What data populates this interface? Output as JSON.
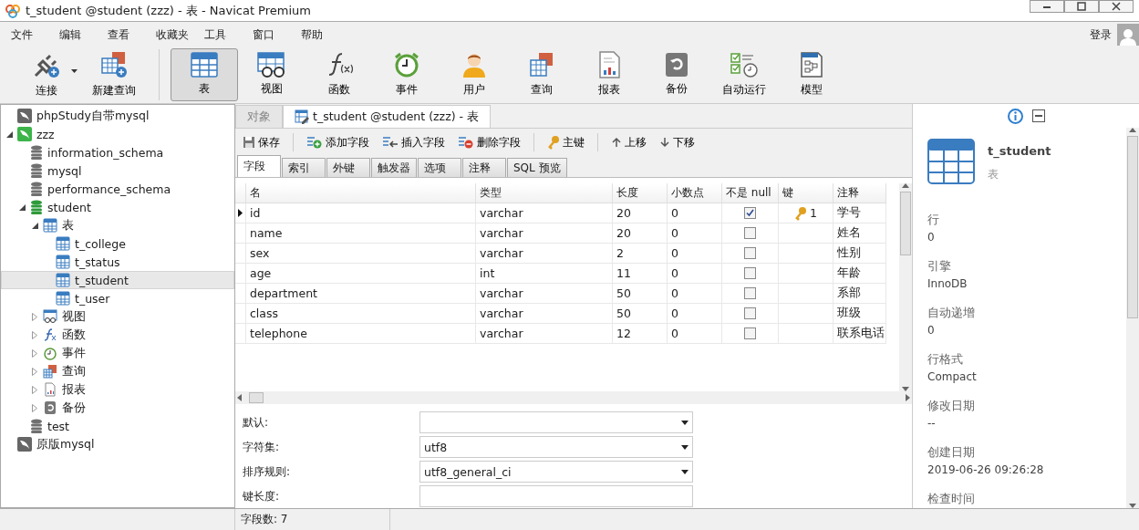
{
  "window": {
    "title": "t_student @student (zzz) - 表 - Navicat Premium"
  },
  "menu": [
    "文件",
    "编辑",
    "查看",
    "收藏夹",
    "工具",
    "窗口",
    "帮助"
  ],
  "login": "登录",
  "toolbar": [
    {
      "label": "连接",
      "kind": "connect",
      "selected": false,
      "dropdown": true
    },
    {
      "label": "新建查询",
      "kind": "new-query",
      "selected": false,
      "dropdown": false
    },
    {
      "label": "表",
      "kind": "table",
      "selected": true,
      "dropdown": false
    },
    {
      "label": "视图",
      "kind": "view",
      "selected": false,
      "dropdown": false
    },
    {
      "label": "函数",
      "kind": "function",
      "selected": false,
      "dropdown": false
    },
    {
      "label": "事件",
      "kind": "event",
      "selected": false,
      "dropdown": false
    },
    {
      "label": "用户",
      "kind": "user",
      "selected": false,
      "dropdown": false
    },
    {
      "label": "查询",
      "kind": "query",
      "selected": false,
      "dropdown": false
    },
    {
      "label": "报表",
      "kind": "report",
      "selected": false,
      "dropdown": false
    },
    {
      "label": "备份",
      "kind": "backup",
      "selected": false,
      "dropdown": false
    },
    {
      "label": "自动运行",
      "kind": "schedule",
      "selected": false,
      "dropdown": false
    },
    {
      "label": "模型",
      "kind": "model",
      "selected": false,
      "dropdown": false
    }
  ],
  "sidebar": {
    "items": [
      {
        "label": "phpStudy自带mysql",
        "kind": "connection",
        "open": false,
        "selected": false
      },
      {
        "label": "zzz",
        "kind": "connection",
        "open": true,
        "selected": false,
        "expanded": true,
        "children": [
          {
            "label": "information_schema",
            "kind": "database",
            "open": false,
            "selected": false
          },
          {
            "label": "mysql",
            "kind": "database",
            "open": false,
            "selected": false
          },
          {
            "label": "performance_schema",
            "kind": "database",
            "open": false,
            "selected": false
          },
          {
            "label": "student",
            "kind": "database",
            "open": true,
            "selected": false,
            "expanded": true,
            "children": [
              {
                "label": "表",
                "kind": "table",
                "selected": false,
                "expanded": true,
                "children": [
                  {
                    "label": "t_college",
                    "kind": "table",
                    "selected": false
                  },
                  {
                    "label": "t_status",
                    "kind": "table",
                    "selected": false
                  },
                  {
                    "label": "t_student",
                    "kind": "table",
                    "selected": true
                  },
                  {
                    "label": "t_user",
                    "kind": "table",
                    "selected": false
                  }
                ]
              },
              {
                "label": "视图",
                "kind": "view",
                "selected": false,
                "expanded": false
              },
              {
                "label": "函数",
                "kind": "function",
                "selected": false,
                "expanded": false
              },
              {
                "label": "事件",
                "kind": "event",
                "selected": false,
                "expanded": false
              },
              {
                "label": "查询",
                "kind": "query",
                "selected": false,
                "expanded": false
              },
              {
                "label": "报表",
                "kind": "report",
                "selected": false,
                "expanded": false
              },
              {
                "label": "备份",
                "kind": "backup",
                "selected": false,
                "expanded": false
              }
            ]
          },
          {
            "label": "test",
            "kind": "database",
            "open": false,
            "selected": false
          }
        ]
      },
      {
        "label": "原版mysql",
        "kind": "connection",
        "open": false,
        "selected": false
      }
    ]
  },
  "tabs": [
    {
      "label": "对象",
      "selected": false,
      "kind": "plain"
    },
    {
      "label": "t_student @student (zzz) - 表",
      "selected": true,
      "kind": "table-edit"
    }
  ],
  "editor_toolbar": [
    {
      "label": "保存",
      "kind": "save"
    },
    {
      "label": "添加字段",
      "kind": "add"
    },
    {
      "label": "插入字段",
      "kind": "insert"
    },
    {
      "label": "删除字段",
      "kind": "delete"
    },
    {
      "label": "主键",
      "kind": "key"
    },
    {
      "label": "上移",
      "kind": "up"
    },
    {
      "label": "下移",
      "kind": "down"
    }
  ],
  "sub_tabs": [
    {
      "label": "字段",
      "selected": true
    },
    {
      "label": "索引",
      "selected": false
    },
    {
      "label": "外键",
      "selected": false
    },
    {
      "label": "触发器",
      "selected": false
    },
    {
      "label": "选项",
      "selected": false
    },
    {
      "label": "注释",
      "selected": false
    },
    {
      "label": "SQL 预览",
      "selected": false
    }
  ],
  "table": {
    "columns": [
      "名",
      "类型",
      "长度",
      "小数点",
      "不是 null",
      "键",
      "注释"
    ],
    "rows": [
      {
        "current": true,
        "name": "id",
        "type": "varchar",
        "length": "20",
        "decimals": "0",
        "not_null": true,
        "key": "1",
        "comment": "学号"
      },
      {
        "current": false,
        "name": "name",
        "type": "varchar",
        "length": "20",
        "decimals": "0",
        "not_null": false,
        "comment": "姓名"
      },
      {
        "current": false,
        "name": "sex",
        "type": "varchar",
        "length": "2",
        "decimals": "0",
        "not_null": false,
        "comment": "性别"
      },
      {
        "current": false,
        "name": "age",
        "type": "int",
        "length": "11",
        "decimals": "0",
        "not_null": false,
        "comment": "年龄"
      },
      {
        "current": false,
        "name": "department",
        "type": "varchar",
        "length": "50",
        "decimals": "0",
        "not_null": false,
        "comment": "系部"
      },
      {
        "current": false,
        "name": "class",
        "type": "varchar",
        "length": "50",
        "decimals": "0",
        "not_null": false,
        "comment": "班级"
      },
      {
        "current": false,
        "name": "telephone",
        "type": "varchar",
        "length": "12",
        "decimals": "0",
        "not_null": false,
        "comment": "联系电话"
      }
    ]
  },
  "field_properties": [
    {
      "label": "默认:",
      "kind": "dropdown"
    },
    {
      "label": "字符集:",
      "kind": "dropdown",
      "value": "utf8"
    },
    {
      "label": "排序规则:",
      "kind": "dropdown",
      "value": "utf8_general_ci"
    },
    {
      "label": "键长度:",
      "kind": "text"
    }
  ],
  "status_bar": "字段数: 7",
  "info_panel": {
    "title": "t_student",
    "subtitle": "表",
    "properties": [
      {
        "label": "行",
        "value": "0"
      },
      {
        "label": "引擎",
        "value": "InnoDB"
      },
      {
        "label": "自动递增",
        "value": "0"
      },
      {
        "label": "行格式",
        "value": "Compact"
      },
      {
        "label": "修改日期",
        "value": "--"
      },
      {
        "label": "创建日期",
        "value": "2019-06-26 09:26:28"
      },
      {
        "label": "检查时间"
      }
    ]
  }
}
